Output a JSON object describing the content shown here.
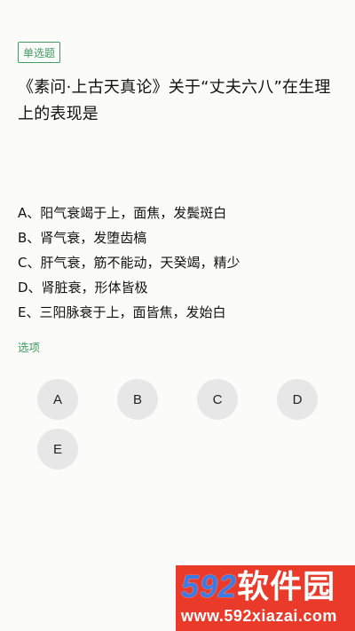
{
  "question": {
    "type_tag": "单选题",
    "text": "《素问·上古天真论》关于“丈夫六八”在生理上的表现是"
  },
  "options": [
    "A、阳气衰竭于上，面焦，发鬓斑白",
    "B、肾气衰，发堕齿槁",
    "C、肝气衰，筋不能动，天癸竭，精少",
    "D、肾脏衰，形体皆极",
    "E、三阳脉衰于上，面皆焦，发始白"
  ],
  "choices": {
    "label": "选项",
    "items": [
      "A",
      "B",
      "C",
      "D",
      "E"
    ]
  },
  "watermark": {
    "number": "592",
    "brand": "软件园",
    "url": "www.592xiazai.com"
  },
  "colors": {
    "accent_green": "#3f9b63",
    "choice_bg": "#e7e7e7",
    "watermark_red": "#e93a2a",
    "watermark_blue": "#3b7be6"
  }
}
